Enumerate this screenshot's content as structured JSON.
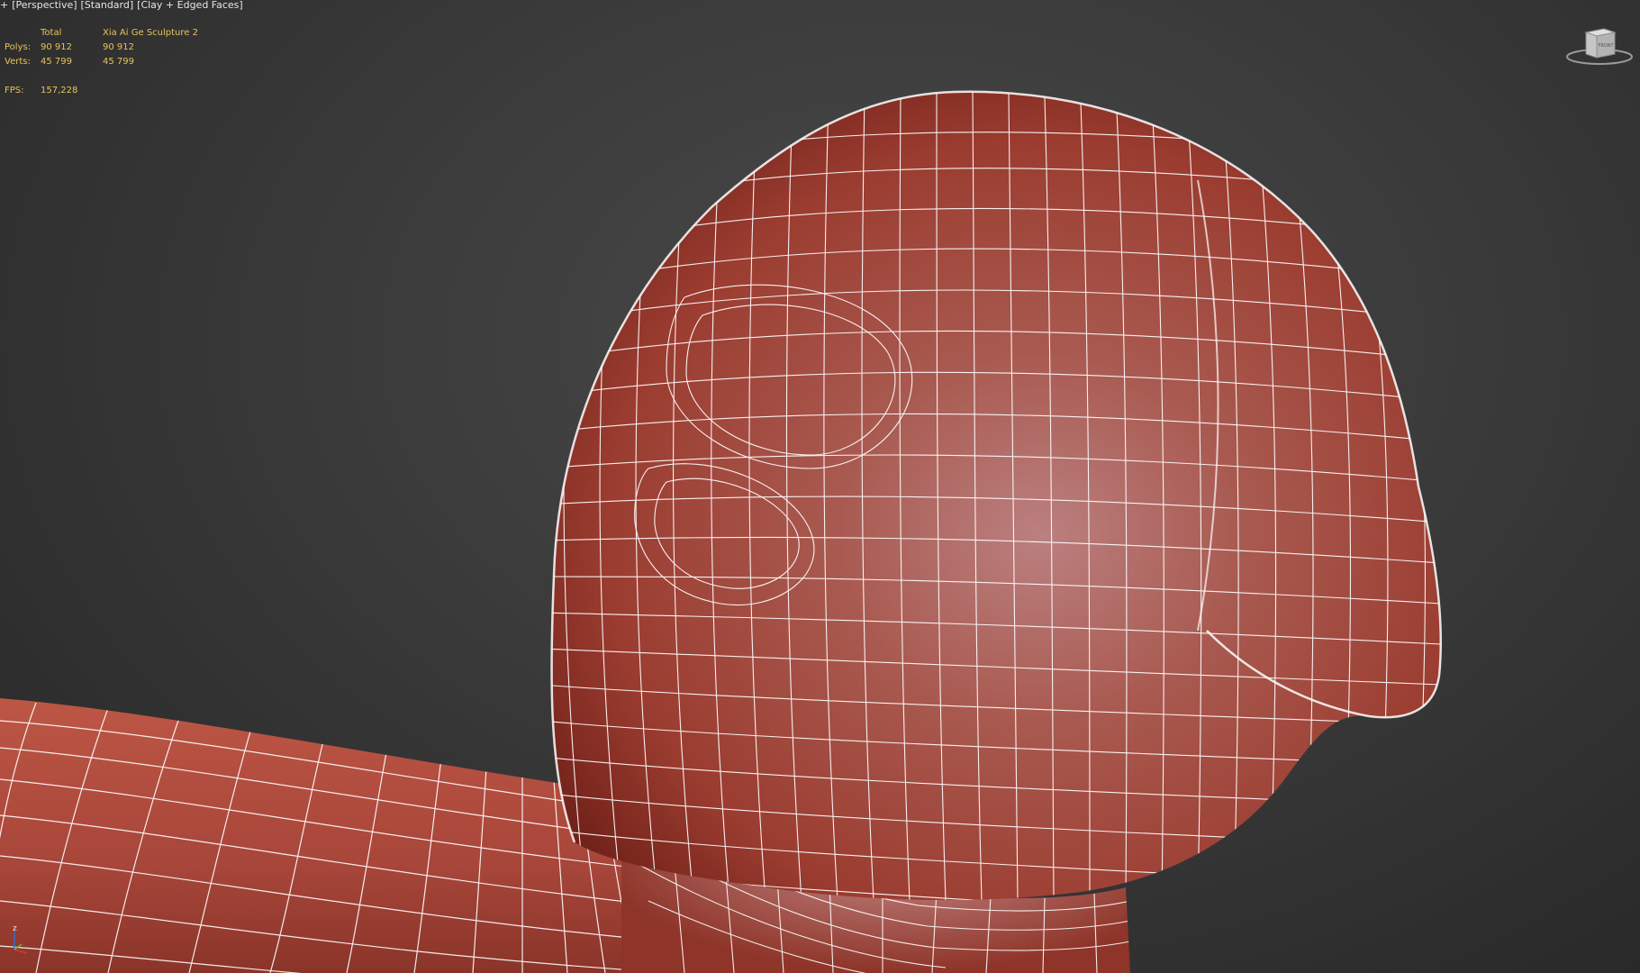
{
  "viewport": {
    "label_parts": [
      "+",
      "[Perspective]",
      "[Standard]",
      "[Clay + Edged Faces]"
    ]
  },
  "stats": {
    "header_blank": "",
    "header_total": "Total",
    "header_object": "Xia Ai Ge Sculpture 2",
    "polys_label": "Polys:",
    "polys_total": "90 912",
    "polys_object": "90 912",
    "verts_label": "Verts:",
    "verts_total": "45 799",
    "verts_object": "45 799"
  },
  "fps": {
    "label": "FPS:",
    "value": "157,228"
  },
  "viewcube": {
    "face_label": "FRONT",
    "icon": "viewcube-icon"
  },
  "axis": {
    "z_label": "z",
    "icon": "axis-tripod-icon"
  },
  "colors": {
    "background": "#3a3a3a",
    "clay": "#b3483b",
    "wire": "#ffffff",
    "stats_text": "#e8c35c",
    "label_text": "#e6e6e6"
  }
}
